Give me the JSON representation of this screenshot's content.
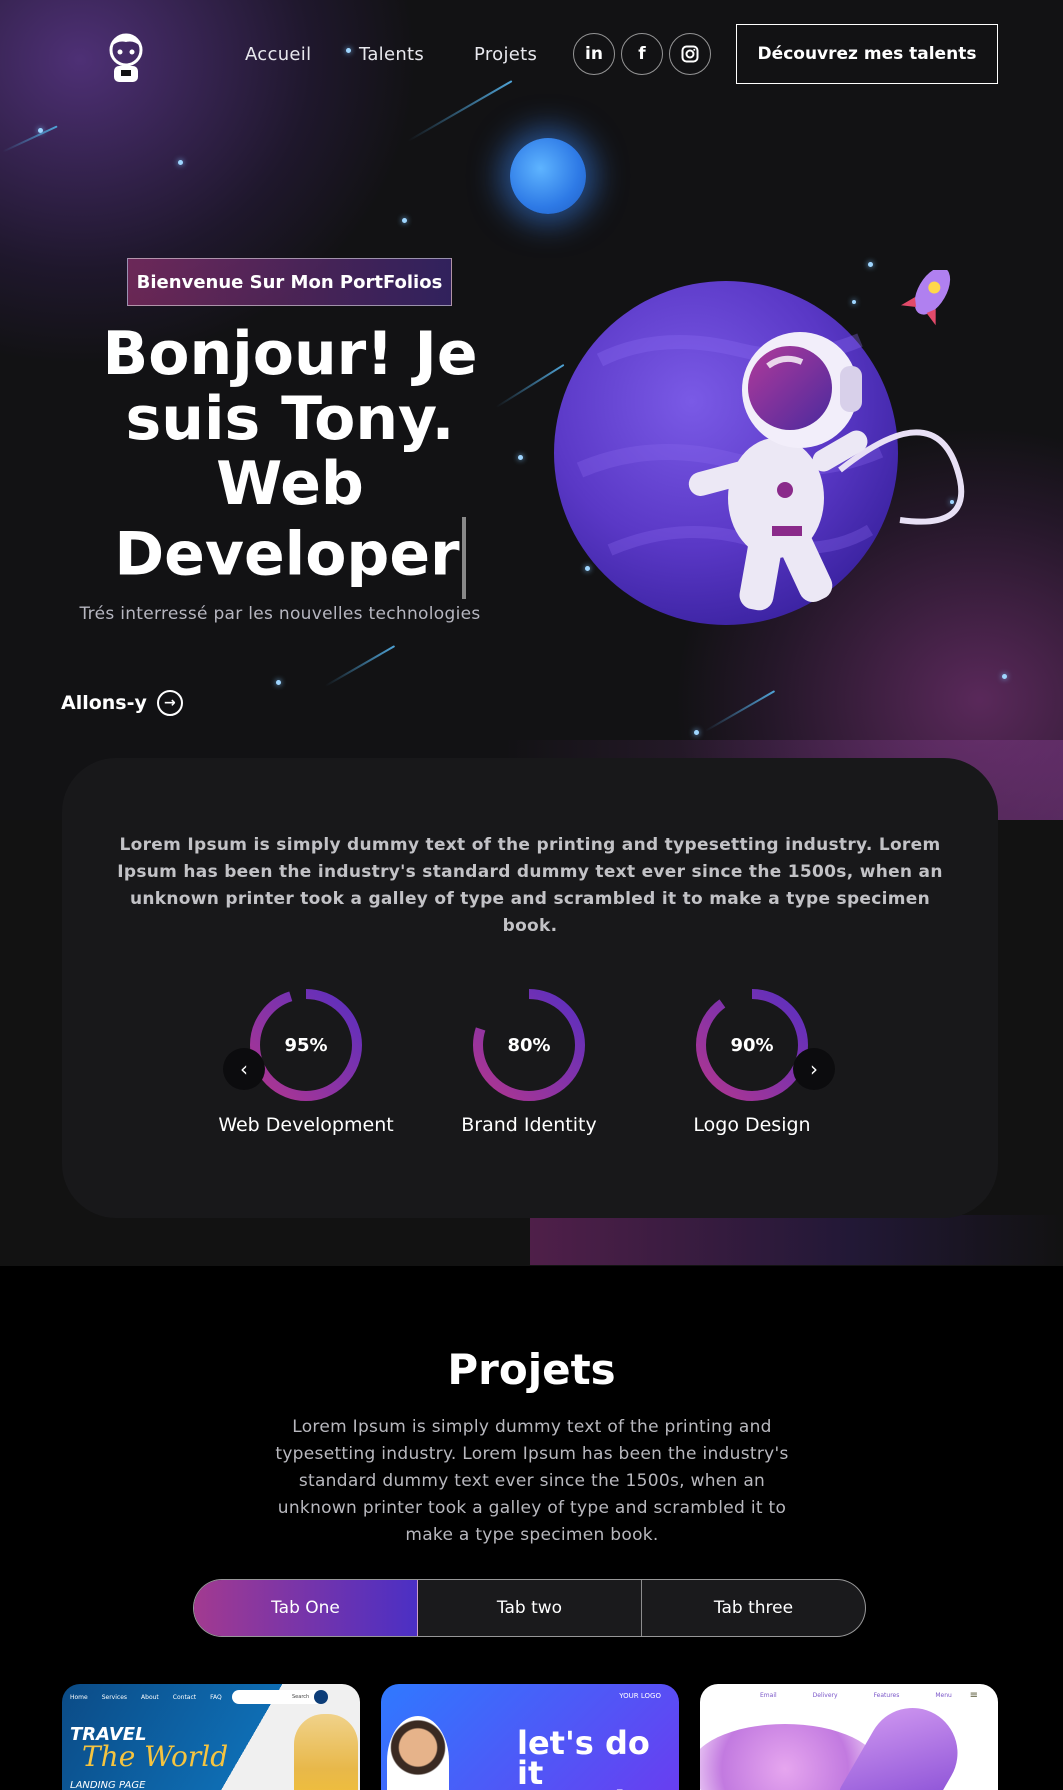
{
  "nav": {
    "links": [
      "Accueil",
      "Talents",
      "Projets"
    ],
    "social": [
      {
        "icon": "linkedin-icon",
        "glyph": "in"
      },
      {
        "icon": "facebook-icon",
        "glyph": "f"
      },
      {
        "icon": "instagram-icon",
        "glyph": ""
      }
    ],
    "cta_label": "Découvrez mes talents"
  },
  "hero": {
    "badge": "Bienvenue Sur Mon PortFolios",
    "headline": "Bonjour! Je suis Tony. Web Developer",
    "tagline": "Trés interressé par les nouvelles technologies",
    "action_label": "Allons-y"
  },
  "skills": {
    "text": "Lorem Ipsum is simply dummy text of the printing and typesetting industry. Lorem Ipsum has been the industry's standard dummy text ever since the 1500s, when an unknown printer took a galley of type and scrambled it to make a type specimen book.",
    "items": [
      {
        "name": "Web Development",
        "percent_label": "95%",
        "value": 0.95
      },
      {
        "name": "Brand Identity",
        "percent_label": "80%",
        "value": 0.8
      },
      {
        "name": "Logo Design",
        "percent_label": "90%",
        "value": 0.9
      }
    ]
  },
  "projects": {
    "title": "Projets",
    "text": "Lorem Ipsum is simply dummy text of the printing and typesetting industry. Lorem Ipsum has been the industry's standard dummy text ever since the 1500s, when an unknown printer took a galley of type and scrambled it to make a type specimen book.",
    "tabs": [
      "Tab One",
      "Tab two",
      "Tab three"
    ],
    "active_tab": 0,
    "thumbs": {
      "travel": {
        "nav": [
          "Home",
          "Services",
          "About",
          "Contact",
          "FAQ"
        ],
        "search": "Search",
        "title1": "TRAVEL",
        "title2": "The World",
        "subtitle": "LANDING PAGE"
      },
      "letsdo": {
        "slogan": "let's do it together",
        "logo": "YOUR LOGO"
      },
      "rocket": {
        "nav": [
          "Email",
          "Delivery",
          "Features",
          "Menu"
        ]
      }
    }
  },
  "colors": {
    "background": "#121212",
    "accent_start": "#a23a90",
    "accent_end": "#4b2fc4"
  }
}
